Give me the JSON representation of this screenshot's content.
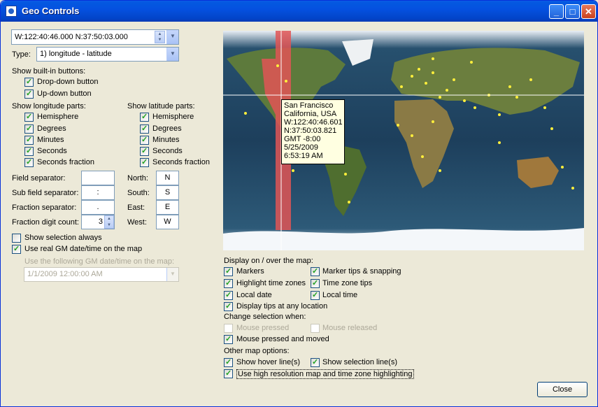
{
  "window": {
    "title": "Geo Controls"
  },
  "geo_input": {
    "value": "W:122:40:46.000   N:37:50:03.000"
  },
  "type": {
    "label": "Type:",
    "value": "1) longitude - latitude"
  },
  "builtin": {
    "heading": "Show built-in buttons:",
    "dropdown": "Drop-down button",
    "updown": "Up-down button"
  },
  "longitude": {
    "heading": "Show longitude parts:",
    "items": [
      "Hemisphere",
      "Degrees",
      "Minutes",
      "Seconds",
      "Seconds fraction"
    ]
  },
  "latitude": {
    "heading": "Show latitude parts:",
    "items": [
      "Hemisphere",
      "Degrees",
      "Minutes",
      "Seconds",
      "Seconds fraction"
    ]
  },
  "separators": {
    "field_label": "Field separator:",
    "field_value": "",
    "subfield_label": "Sub field separator:",
    "subfield_value": ":",
    "fraction_label": "Fraction separator:",
    "fraction_value": ".",
    "digit_label": "Fraction digit count:",
    "digit_value": "3"
  },
  "hemis": {
    "north_label": "North:",
    "north_value": "N",
    "south_label": "South:",
    "south_value": "S",
    "east_label": "East:",
    "east_value": "E",
    "west_label": "West:",
    "west_value": "W"
  },
  "options": {
    "show_selection": "Show selection always",
    "use_real": "Use real GM date/time on the map",
    "use_following": "Use the following GM date/time on the map:",
    "datetime_value": "1/1/2009  12:00:00 AM"
  },
  "tooltip": {
    "lines": [
      "San Francisco",
      "California, USA",
      "W:122:40:46.601",
      "N:37:50:03.821",
      "GMT -8:00",
      "5/25/2009",
      "6:53:19 AM"
    ]
  },
  "display": {
    "heading": "Display on / over the map:",
    "markers": "Markers",
    "marker_tips": "Marker tips & snapping",
    "highlight_tz": "Highlight time zones",
    "tz_tips": "Time zone tips",
    "local_date": "Local date",
    "local_time": "Local time",
    "tips_any": "Display tips at any location"
  },
  "change": {
    "heading": "Change selection when:",
    "mouse_pressed": "Mouse pressed",
    "mouse_released": "Mouse released",
    "pressed_moved": "Mouse pressed and moved"
  },
  "other": {
    "heading": "Other map options:",
    "hover_line": "Show hover line(s)",
    "selection_line": "Show selection line(s)",
    "high_res": "Use high resolution map and time zone highlighting"
  },
  "close_label": "Close"
}
